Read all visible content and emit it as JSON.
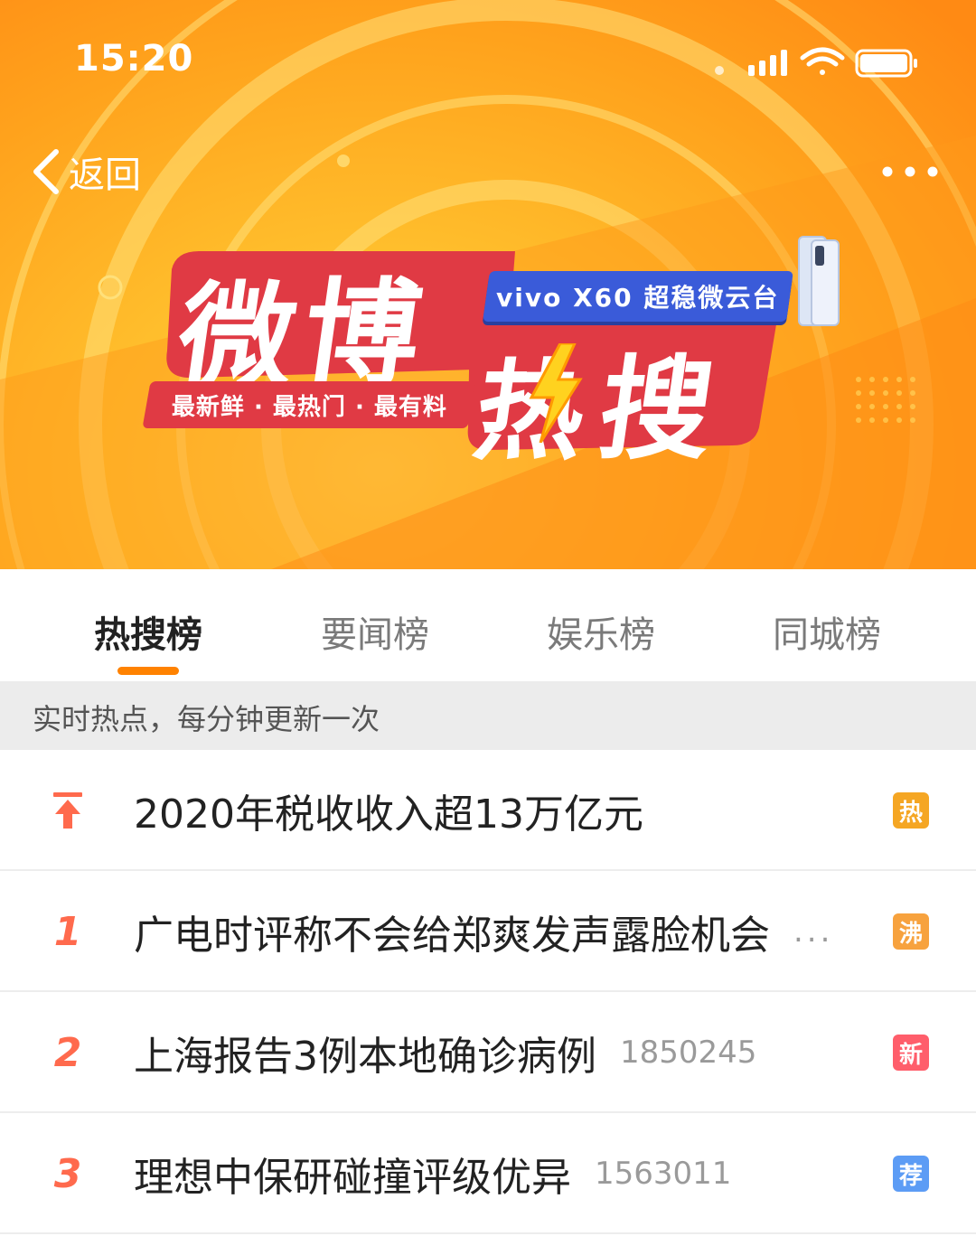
{
  "status_bar": {
    "time": "15:20"
  },
  "nav": {
    "back_label": "返回"
  },
  "banner": {
    "title_chars": [
      "微",
      "博",
      "热",
      "搜"
    ],
    "sponsor_tag": "vivo X60 超稳微云台",
    "slogan": "最新鲜 · 最热门 · 最有料"
  },
  "tabs": [
    {
      "label": "热搜榜",
      "active": true
    },
    {
      "label": "要闻榜",
      "active": false
    },
    {
      "label": "娱乐榜",
      "active": false
    },
    {
      "label": "同城榜",
      "active": false
    }
  ],
  "notice": "实时热点，每分钟更新一次",
  "list": [
    {
      "rank": "",
      "rank_icon": "pinned-top-icon",
      "title": "2020年税收收入超13万亿元",
      "count": "",
      "truncated": false,
      "badge": "热",
      "badge_color": "#f5a623"
    },
    {
      "rank": "1",
      "title": "广电时评称不会给郑爽发声露脸机会",
      "count": "",
      "truncated": true,
      "ellipsis": "...",
      "badge": "沸",
      "badge_color": "#f7a23e"
    },
    {
      "rank": "2",
      "title": "上海报告3例本地确诊病例",
      "count": "1850245",
      "truncated": false,
      "badge": "新",
      "badge_color": "#ff5e6b"
    },
    {
      "rank": "3",
      "title": "理想中保研碰撞评级优异",
      "count": "1563011",
      "truncated": false,
      "badge": "荐",
      "badge_color": "#5c9cf5"
    }
  ],
  "colors": {
    "accent": "#ff8200",
    "rank": "#ff6a4d",
    "banner_red": "#e03a44",
    "banner_blue": "#3a5bd9"
  }
}
